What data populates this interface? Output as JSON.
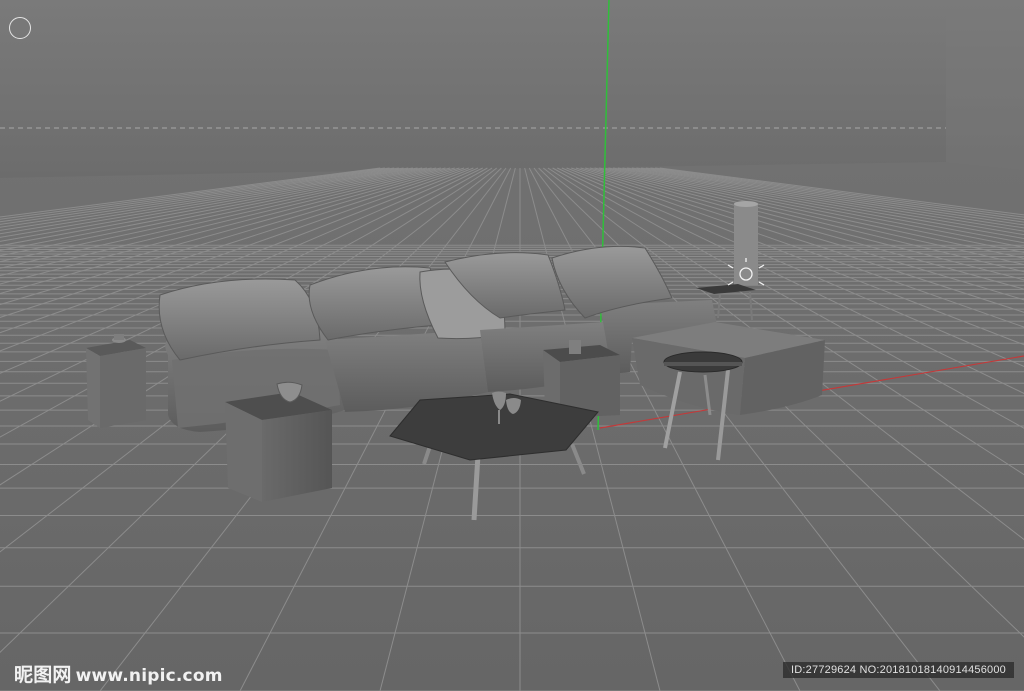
{
  "viewport": {
    "background_sky": "#747474",
    "background_floor": "#6e6e6e",
    "grid_color": "#8a8a8a",
    "axis_y_color": "#2fbf3a",
    "axis_x_color": "#c23a3a",
    "horizon_dash_color": "#9a9a9a",
    "gizmo_icon": "rotate-circle-icon"
  },
  "watermark": {
    "brand": "昵图网",
    "site": "www.nipic.com",
    "id_text": "ID:27729624 NO:20181018140914456000"
  }
}
